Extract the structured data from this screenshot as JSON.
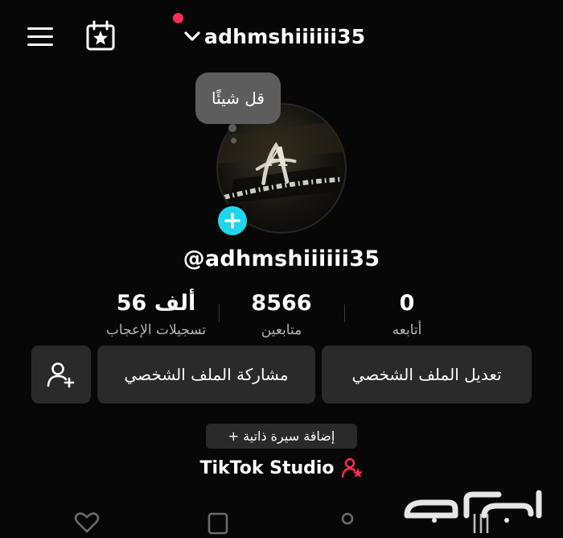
{
  "header": {
    "username": "adhmshiiiiii35",
    "notification_dot_color": "#fe2c55",
    "menu_icon": "hamburger-menu-icon",
    "calendar_icon": "calendar-star-icon"
  },
  "avatar": {
    "bubble_text": "قل شيئًا",
    "logo_letter": "A",
    "add_color": "#20d5ec"
  },
  "profile": {
    "handle": "@adhmshiiiiii35"
  },
  "stats": [
    {
      "value": "0",
      "label": "أتابعه"
    },
    {
      "value": "8566",
      "label": "متابعين"
    },
    {
      "value": "56 ألف",
      "label": "تسجيلات الإعجاب"
    }
  ],
  "actions": {
    "edit_profile": "تعديل الملف الشخصي",
    "share_profile": "مشاركة الملف الشخصي",
    "add_friend_icon": "add-user-icon",
    "add_bio": "+ إضافة سيرة ذاتية"
  },
  "studio": {
    "label": "TikTok Studio",
    "icon_color": "#fe2c55"
  },
  "watermark": {
    "text": "حراج"
  }
}
